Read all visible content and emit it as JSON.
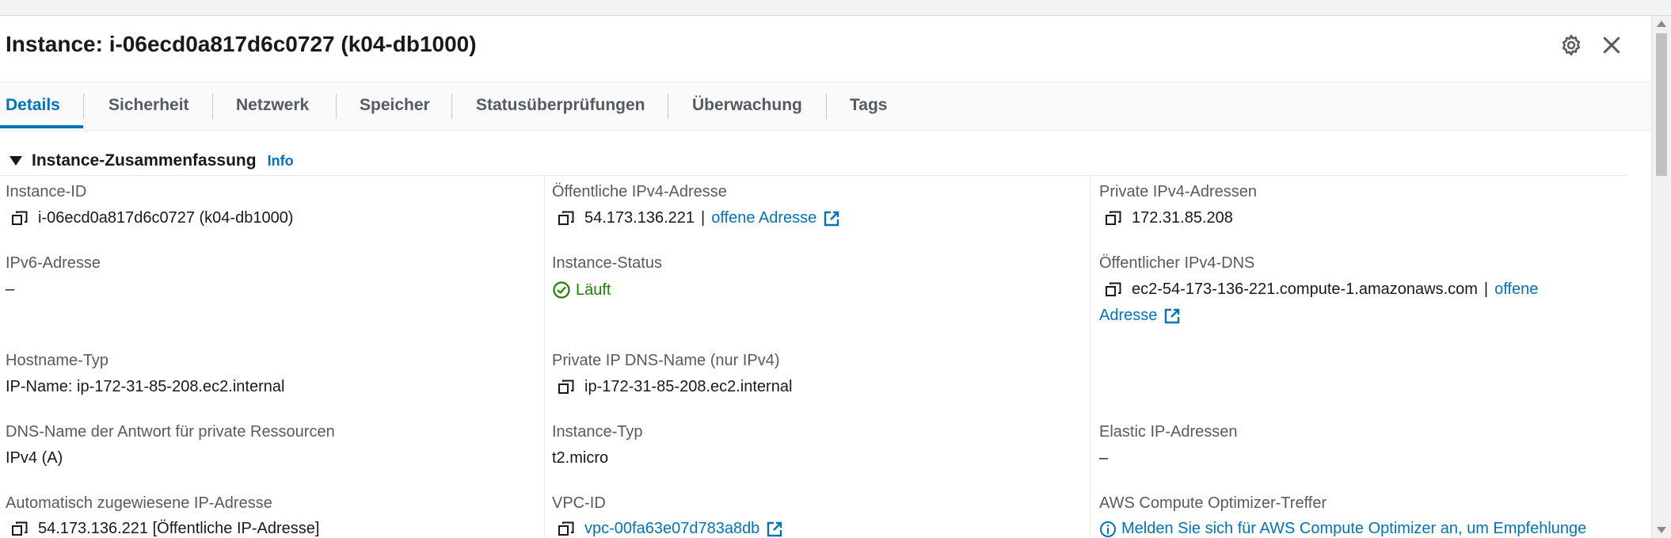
{
  "panel": {
    "title": "Instance: i-06ecd0a817d6c0727 (k04-db1000)"
  },
  "header_icons": {
    "settings": "gear-icon",
    "close": "close-icon",
    "drag": "drag-handle-icon"
  },
  "tabs": [
    {
      "label": "Details",
      "active": true
    },
    {
      "label": "Sicherheit",
      "active": false
    },
    {
      "label": "Netzwerk",
      "active": false
    },
    {
      "label": "Speicher",
      "active": false
    },
    {
      "label": "Statusüberprüfungen",
      "active": false
    },
    {
      "label": "Überwachung",
      "active": false
    },
    {
      "label": "Tags",
      "active": false
    }
  ],
  "section": {
    "title": "Instance-Zusammenfassung",
    "info_link": "Info"
  },
  "fields": {
    "instance_id": {
      "label": "Instance-ID",
      "value": "i-06ecd0a817d6c0727 (k04-db1000)"
    },
    "public_ipv4": {
      "label": "Öffentliche IPv4-Adresse",
      "value": "54.173.136.221",
      "separator": "|",
      "link": "offene Adresse"
    },
    "private_ipv4": {
      "label": "Private IPv4-Adressen",
      "value": "172.31.85.208"
    },
    "ipv6": {
      "label": "IPv6-Adresse",
      "value": "–"
    },
    "instance_state": {
      "label": "Instance-Status",
      "value": "Läuft"
    },
    "public_dns": {
      "label": "Öffentlicher IPv4-DNS",
      "value": "ec2-54-173-136-221.compute-1.amazonaws.com",
      "separator": "|",
      "link_line1": "offene",
      "link_line2": "Adresse"
    },
    "hostname_type": {
      "label": "Hostname-Typ",
      "value": "IP-Name: ip-172-31-85-208.ec2.internal"
    },
    "private_dns": {
      "label": "Private IP DNS-Name (nur IPv4)",
      "value": "ip-172-31-85-208.ec2.internal"
    },
    "dns_answer": {
      "label": "DNS-Name der Antwort für private Ressourcen",
      "value": "IPv4 (A)"
    },
    "instance_type": {
      "label": "Instance-Typ",
      "value": "t2.micro"
    },
    "elastic_ip": {
      "label": "Elastic IP-Adressen",
      "value": "–"
    },
    "auto_ip": {
      "label": "Automatisch zugewiesene IP-Adresse",
      "value": "54.173.136.221 [Öffentliche IP-Adresse]"
    },
    "vpc_id": {
      "label": "VPC-ID",
      "value": "vpc-00fa63e07d783a8db"
    },
    "optimizer": {
      "label": "AWS Compute Optimizer-Treffer",
      "value": "Melden Sie sich für AWS Compute Optimizer an, um Empfehlunge"
    }
  },
  "colors": {
    "link": "#0073bb",
    "status_ok": "#1d8102",
    "label": "#545b64",
    "text": "#16191f"
  }
}
